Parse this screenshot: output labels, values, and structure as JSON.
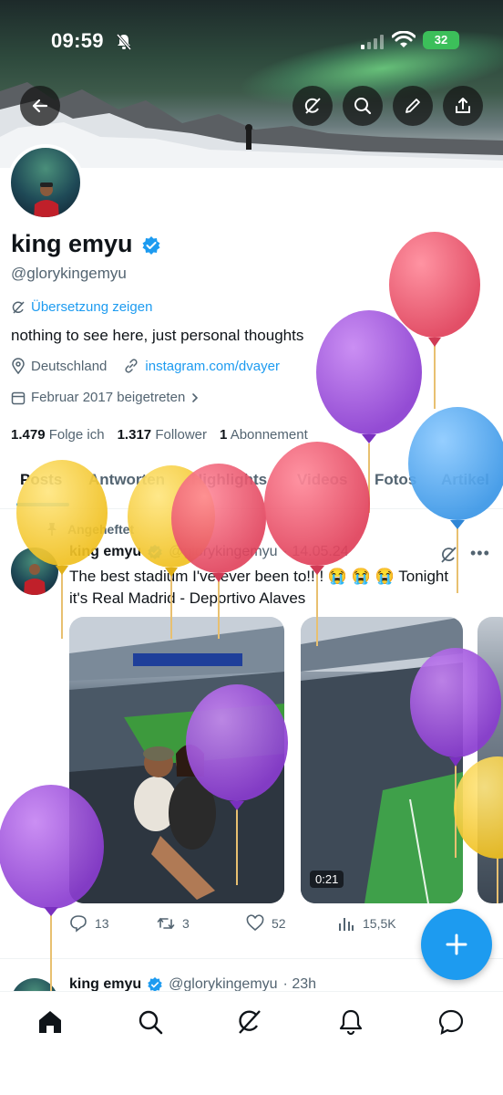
{
  "status_bar": {
    "time": "09:59",
    "battery": "32"
  },
  "profile": {
    "name": "king emyu",
    "handle": "@glorykingemyu",
    "translate_label": "Übersetzung zeigen",
    "bio": "nothing to see here, just personal thoughts",
    "location": "Deutschland",
    "link": "instagram.com/dvayer",
    "joined": "Februar 2017 beigetreten",
    "following_count": "1.479",
    "following_label": "Folge ich",
    "followers_count": "1.317",
    "followers_label": "Follower",
    "subs_count": "1",
    "subs_label": "Abonnement"
  },
  "tabs": [
    "Posts",
    "Antworten",
    "Highlights",
    "Videos",
    "Fotos",
    "Artikel"
  ],
  "pinned_tweet": {
    "pinned_label": "Angeheftet",
    "name": "king emyu",
    "handle": "@glorykingemyu",
    "date": "· 14.05.24",
    "text_line1": "The best stadium I've ever been to!!!! 😭 😭 😭  Tonight",
    "text_line2": "it's Real Madrid - Deportivo Alaves",
    "video_duration": "0:21",
    "replies": "13",
    "retweets": "3",
    "likes": "52",
    "views": "15,5K"
  },
  "second_tweet": {
    "name": "king emyu",
    "handle": "@glorykingemyu",
    "time": "· 23h"
  },
  "icons": {
    "back": "arrow-left-icon",
    "grok": "grok-icon",
    "search": "search-icon",
    "edit": "pencil-icon",
    "share": "share-icon",
    "location": "location-pin-icon",
    "link": "link-icon",
    "calendar": "calendar-icon",
    "pin": "pin-icon",
    "reply": "reply-icon",
    "retweet": "retweet-icon",
    "like": "heart-icon",
    "views": "views-icon",
    "home": "home-icon",
    "notifications": "bell-icon",
    "messages": "message-icon",
    "compose": "plus-icon"
  },
  "colors": {
    "accent": "#1d9bf0",
    "text": "#0f1419",
    "secondary_text": "#536471",
    "balloon_yellow": "#f5cf3a",
    "balloon_red": "#e8506a",
    "balloon_purple": "#9a4fd8",
    "balloon_blue": "#4aa6ee"
  }
}
